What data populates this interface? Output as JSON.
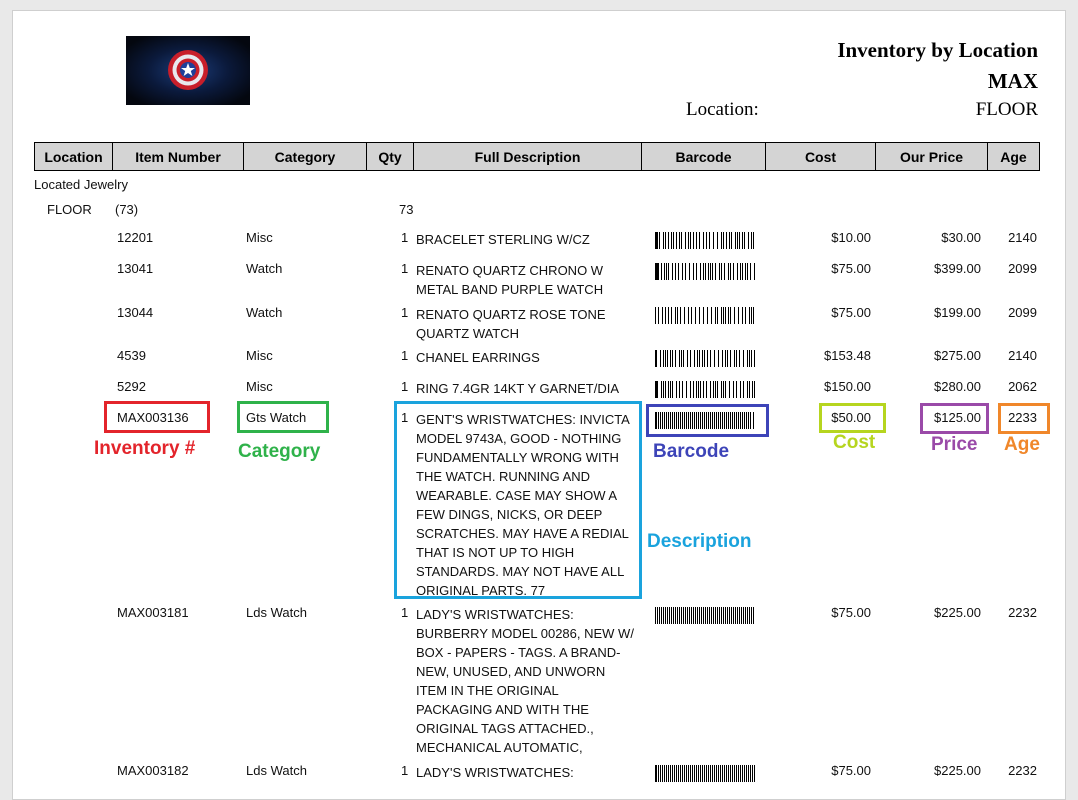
{
  "header": {
    "title": "Inventory by Location",
    "store": "MAX",
    "location_label": "Location:",
    "location_value": "FLOOR"
  },
  "columns": [
    "Location",
    "Item Number",
    "Category",
    "Qty",
    "Full Description",
    "Barcode",
    "Cost",
    "Our Price",
    "Age"
  ],
  "section": "Located Jewelry",
  "group": {
    "location": "FLOOR",
    "count": "(73)",
    "qty_total": "73"
  },
  "rows": [
    {
      "item": "12201",
      "category": "Misc",
      "qty": "1",
      "desc": "BRACELET STERLING W/CZ",
      "cost": "$10.00",
      "price": "$30.00",
      "age": "2140"
    },
    {
      "item": "13041",
      "category": "Watch",
      "qty": "1",
      "desc": "RENATO QUARTZ CHRONO W METAL BAND PURPLE WATCH",
      "cost": "$75.00",
      "price": "$399.00",
      "age": "2099"
    },
    {
      "item": "13044",
      "category": "Watch",
      "qty": "1",
      "desc": "RENATO QUARTZ ROSE TONE QUARTZ WATCH",
      "cost": "$75.00",
      "price": "$199.00",
      "age": "2099"
    },
    {
      "item": "4539",
      "category": "Misc",
      "qty": "1",
      "desc": "CHANEL EARRINGS",
      "cost": "$153.48",
      "price": "$275.00",
      "age": "2140"
    },
    {
      "item": "5292",
      "category": "Misc",
      "qty": "1",
      "desc": "RING 7.4GR 14KT Y GARNET/DIA",
      "cost": "$150.00",
      "price": "$280.00",
      "age": "2062"
    },
    {
      "item": "MAX003136",
      "category": "Gts Watch",
      "qty": "1",
      "desc": "GENT'S WRISTWATCHES: INVICTA MODEL 9743A, GOOD - NOTHING FUNDAMENTALLY WRONG WITH THE WATCH. RUNNING AND WEARABLE. CASE MAY SHOW A FEW DINGS, NICKS, OR DEEP SCRATCHES. MAY HAVE A REDIAL THAT IS NOT UP TO HIGH STANDARDS. MAY NOT HAVE ALL ORIGINAL PARTS. 77",
      "cost": "$50.00",
      "price": "$125.00",
      "age": "2233"
    },
    {
      "item": "MAX003181",
      "category": "Lds Watch",
      "qty": "1",
      "desc": "LADY'S WRISTWATCHES: BURBERRY MODEL 00286, NEW W/ BOX - PAPERS - TAGS. A BRAND-NEW, UNUSED, AND UNWORN ITEM IN THE ORIGINAL PACKAGING AND WITH THE ORIGINAL TAGS ATTACHED., MECHANICAL AUTOMATIC,",
      "cost": "$75.00",
      "price": "$225.00",
      "age": "2232"
    },
    {
      "item": "MAX003182",
      "category": "Lds Watch",
      "qty": "1",
      "desc": "LADY'S WRISTWATCHES:",
      "cost": "$75.00",
      "price": "$225.00",
      "age": "2232"
    }
  ],
  "annotations": {
    "inventory": {
      "label": "Inventory #",
      "color": "#e3242b"
    },
    "category": {
      "label": "Category",
      "color": "#2fb24a"
    },
    "barcode": {
      "label": "Barcode",
      "color": "#3d44b8"
    },
    "description": {
      "label": "Description",
      "color": "#1aa3dd"
    },
    "cost": {
      "label": "Cost",
      "color": "#b6d51f"
    },
    "price": {
      "label": "Price",
      "color": "#9a4aa8"
    },
    "age": {
      "label": "Age",
      "color": "#f0872a"
    }
  }
}
